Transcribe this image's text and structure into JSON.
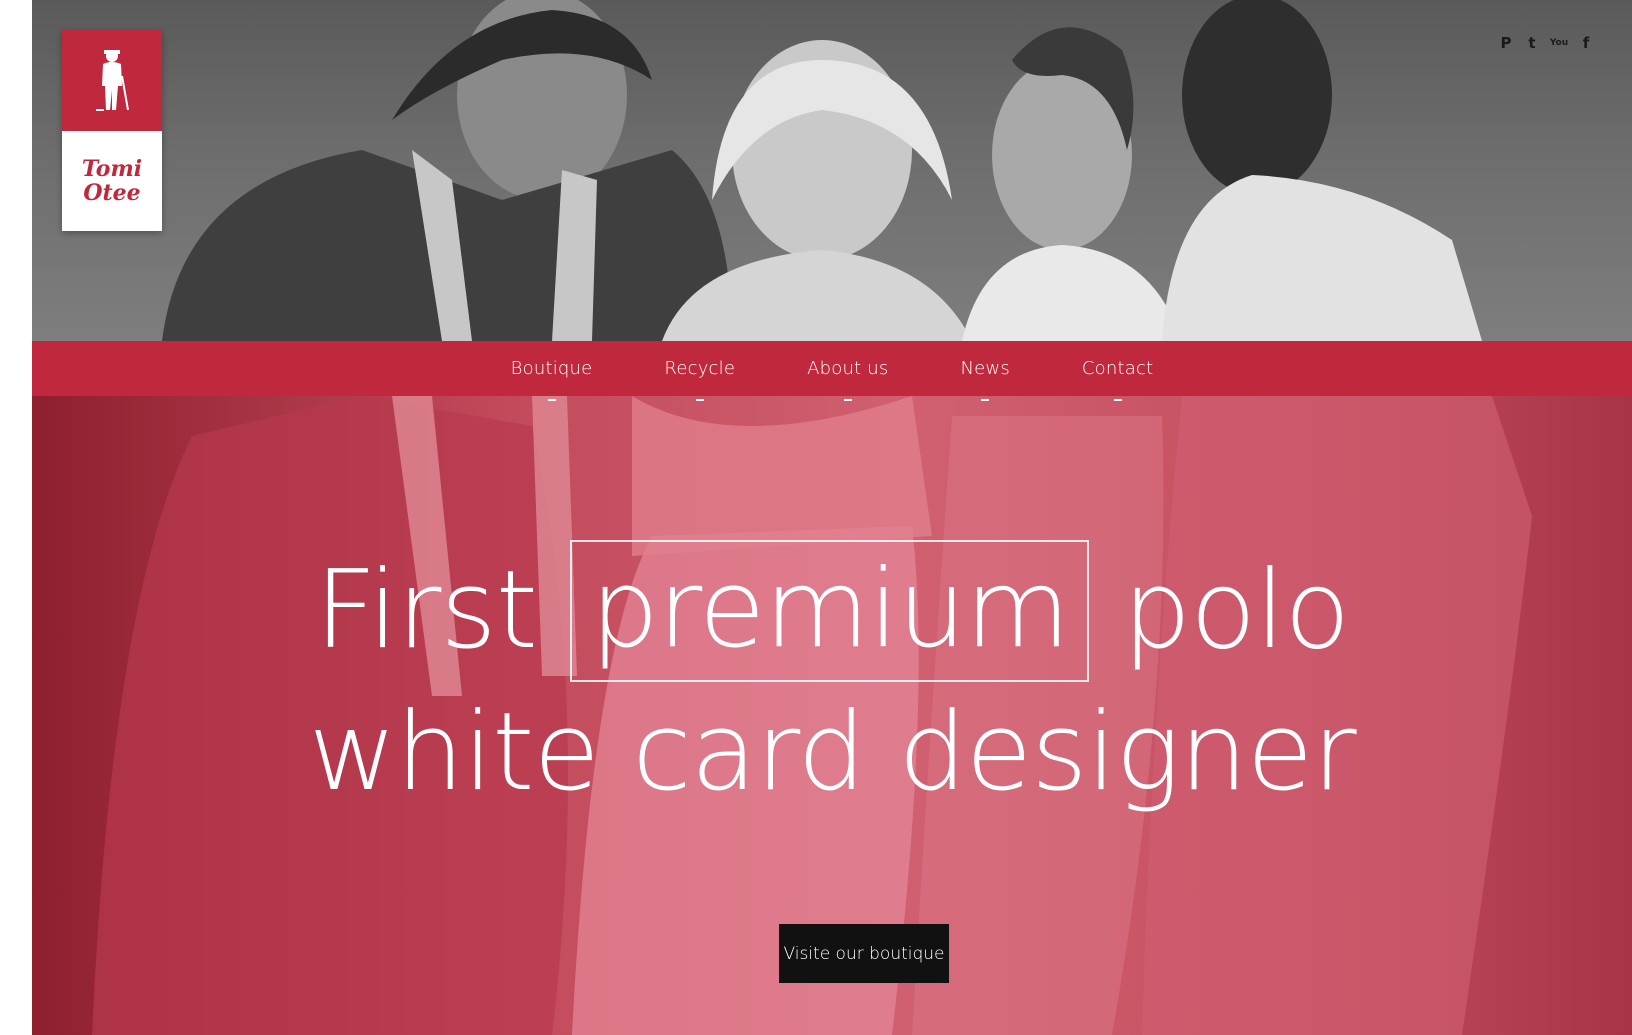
{
  "brand": {
    "name_line1": "Tomi",
    "name_line2": "Otee",
    "primary_color": "#c0283d",
    "logo_icon": "golfer-icon"
  },
  "social": [
    {
      "name": "pinterest-icon",
      "glyph": "P"
    },
    {
      "name": "twitter-icon",
      "glyph": "t"
    },
    {
      "name": "youtube-icon",
      "glyph": "You"
    },
    {
      "name": "facebook-icon",
      "glyph": "f"
    }
  ],
  "nav": {
    "items": [
      {
        "label": "Boutique"
      },
      {
        "label": "Recycle"
      },
      {
        "label": "About us"
      },
      {
        "label": "News"
      },
      {
        "label": "Contact"
      }
    ]
  },
  "hero": {
    "word1": "First",
    "word2_boxed": "premium",
    "word3": "polo",
    "line2": "white card designer",
    "cta_label": "Visite our boutique"
  }
}
